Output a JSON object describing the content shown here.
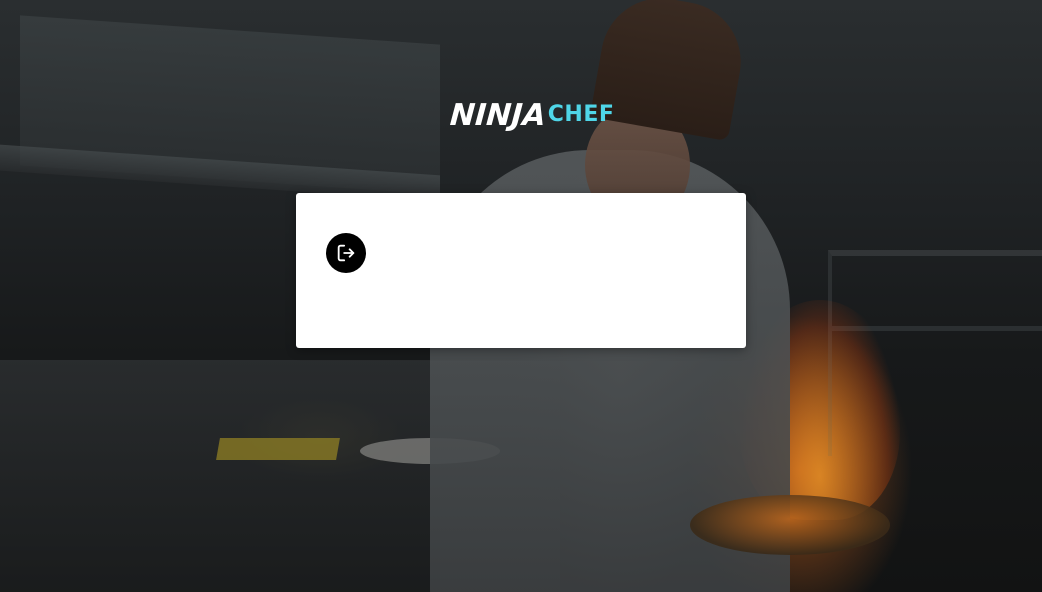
{
  "brand": {
    "name_part1": "NINJA",
    "name_part2": "CHEF",
    "accent_color": "#4fd6e8"
  },
  "background": {
    "description_icon": "kitchen-chef-photo"
  },
  "card": {
    "logout_icon": "logout-icon"
  }
}
